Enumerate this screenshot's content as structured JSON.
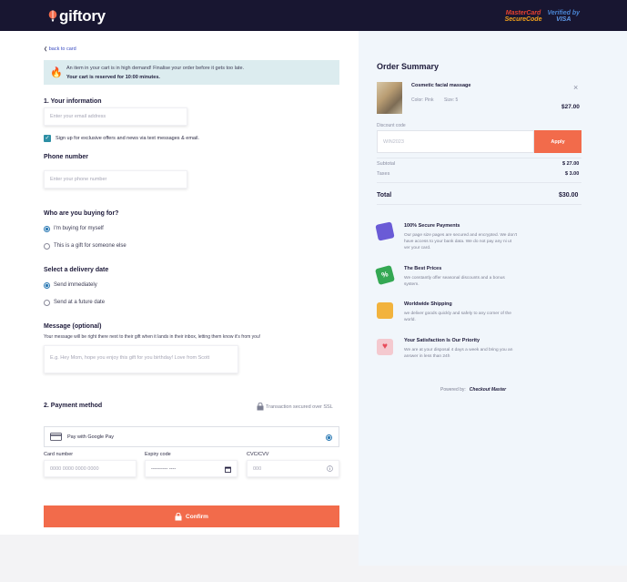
{
  "header": {
    "brand": "giftory",
    "badge_mastercard_1": "MasterCard",
    "badge_mastercard_2": "SecureCode",
    "badge_visa_1": "Verified by",
    "badge_visa_2": "VISA"
  },
  "back_link": "back to card",
  "alert": {
    "line1": "An item in your cart is in high demand! Finalise your order before it gets too late.",
    "line2": "Your cart is reserved for 10:00 minutes.",
    "icon": "fire-icon"
  },
  "info": {
    "title": "1. Your information",
    "email_placeholder": "Enter your email address",
    "signup_label": "Sign up for exclusive offers and news via text messages & email.",
    "signup_checked": true,
    "phone_title": "Phone number",
    "phone_placeholder": "Enter your phone number"
  },
  "buying_for": {
    "title": "Who are you buying for?",
    "options": [
      "I'm buying for myself",
      "This is a gift for someone else"
    ],
    "selected": "I'm buying for myself"
  },
  "delivery": {
    "title": "Select a delivery date",
    "options": [
      "Send immediately",
      "Send at a future date"
    ],
    "selected": "Send immediately"
  },
  "message": {
    "title": "Message (optional)",
    "hint": "Your message will be right there next to their gift when it lands in their inbox, letting them know it's from you!",
    "placeholder": "E.g. Hey Mom, hope you enjoy this gift for you birthday! Love from Scott"
  },
  "payment": {
    "title": "2. Payment method",
    "secure_note": "Transaction secured over SSL",
    "gpay_label": "Pay with Google Pay",
    "card_label": "Card number",
    "card_placeholder": "0000 0000 0000 0000",
    "expiry_label": "Expiry code",
    "expiry_placeholder": "---------- ----",
    "cvc_label": "CVC/CVV",
    "cvc_placeholder": "000",
    "confirm_label": "Confirm"
  },
  "summary": {
    "title": "Order Summary",
    "item_name": "Cosmetic facial massage",
    "item_color": "Color: Pink",
    "item_size": "Size: 5",
    "item_price": "$27.00",
    "discount_label": "Discount code",
    "discount_placeholder": "WIN2023",
    "apply_label": "Apply",
    "subtotal_label": "Subtotal",
    "subtotal_value": "$ 27.00",
    "taxes_label": "Taxes",
    "taxes_value": "$ 3.00",
    "total_label": "Total",
    "total_value": "$30.00"
  },
  "features": [
    {
      "title": "100% Secure Payments",
      "desc": "Our page size pages are secured and encrypted. We don't have access to your bank data. We do not pay any ni ut ver your card.",
      "icon": "secure-card-icon",
      "color": "#6a5bd6"
    },
    {
      "title": "The Best Prices",
      "desc": "We constantly offer seasonal discounts and a bonus system.",
      "icon": "percent-tag-icon",
      "color": "#34a853"
    },
    {
      "title": "Worldwide Shipping",
      "desc": "we deliver goods quickly and safely to any corner of the world.",
      "icon": "package-icon",
      "color": "#f2b33d"
    },
    {
      "title": "Your Satisfaction Is Our Priority",
      "desc": "We are at your disposal 4 days a week and bring you an answer in less than 24h",
      "icon": "heart-hand-icon",
      "color": "#e84b5a"
    }
  ],
  "powered": {
    "label": "Powered by:",
    "brand": "Checkout Master"
  }
}
